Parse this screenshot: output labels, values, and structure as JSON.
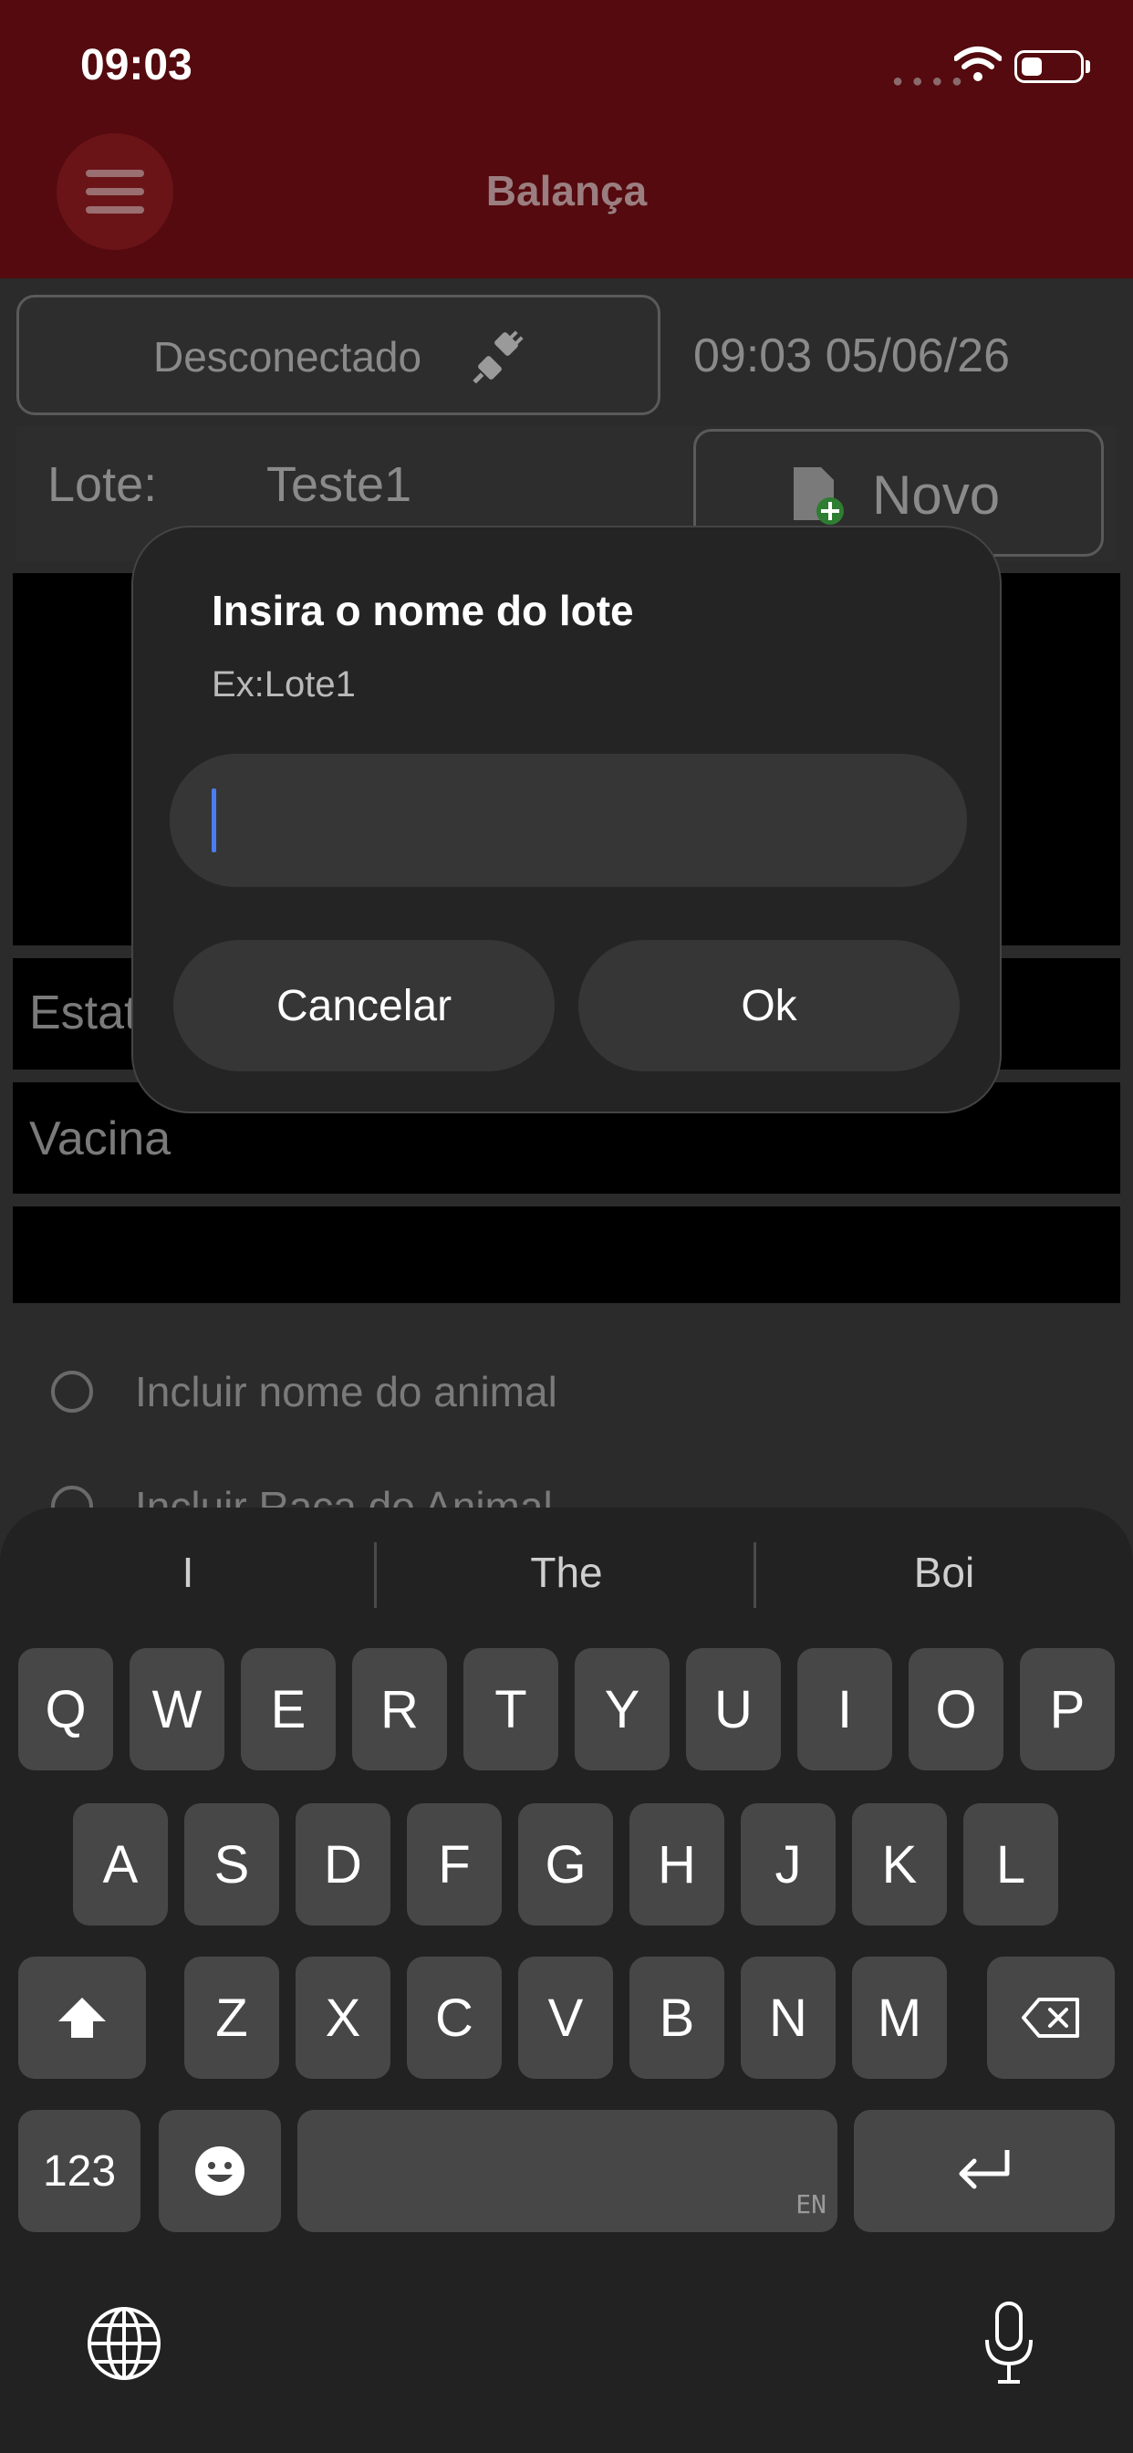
{
  "status_bar": {
    "time": "09:03"
  },
  "header": {
    "title": "Balança"
  },
  "connection": {
    "status_label": "Desconectado",
    "datetime": "09:03 05/06/26"
  },
  "lote": {
    "label": "Lote:",
    "value": "Teste1",
    "new_button_label": "Novo"
  },
  "fields": {
    "estat_label": "Estat",
    "vacina_label": "Vacina"
  },
  "options": [
    {
      "label": "Incluir nome do animal"
    },
    {
      "label": "Incluir Raça do Animal"
    }
  ],
  "dialog": {
    "title": "Insira o nome do lote",
    "hint": "Ex:Lote1",
    "input_value": "",
    "cancel_label": "Cancelar",
    "ok_label": "Ok"
  },
  "keyboard": {
    "suggestions": [
      "I",
      "The",
      "Boi"
    ],
    "row1": [
      "Q",
      "W",
      "E",
      "R",
      "T",
      "Y",
      "U",
      "I",
      "O",
      "P"
    ],
    "row2": [
      "A",
      "S",
      "D",
      "F",
      "G",
      "H",
      "J",
      "K",
      "L"
    ],
    "row3": [
      "Z",
      "X",
      "C",
      "V",
      "B",
      "N",
      "M"
    ],
    "numbers_label": "123",
    "space_lang": "EN"
  }
}
